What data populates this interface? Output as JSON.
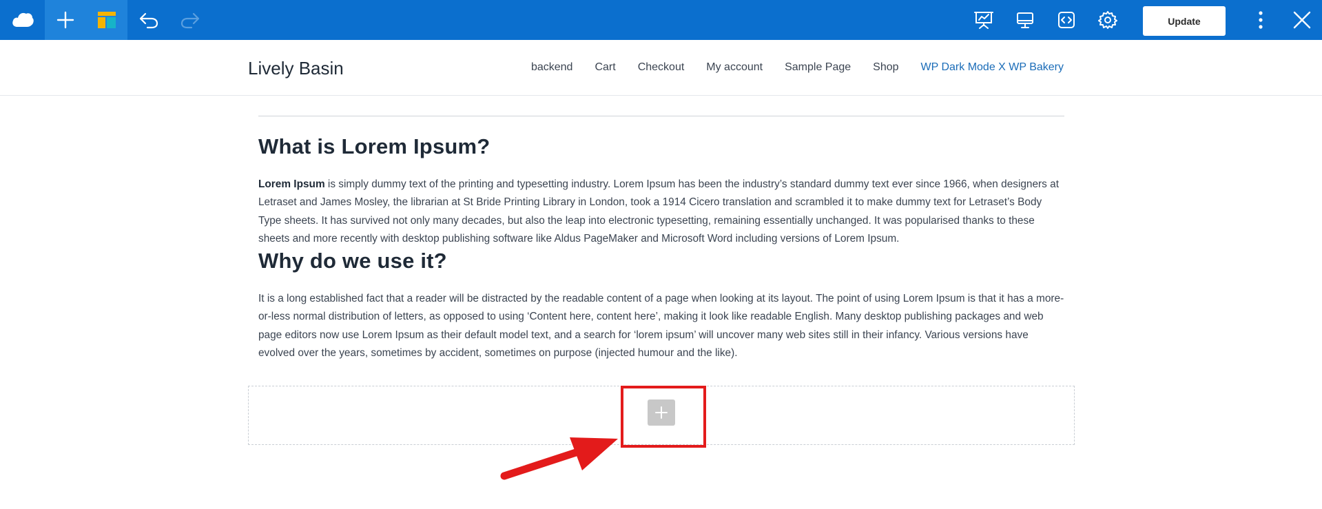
{
  "toolbar": {
    "update_label": "Update",
    "icons": [
      "logo-cloud-icon",
      "add-element-icon",
      "templates-icon",
      "undo-icon",
      "redo-icon",
      "presentation-icon",
      "desktop-preview-icon",
      "code-icon",
      "settings-gear-icon",
      "more-vertical-icon",
      "close-icon"
    ],
    "colors": {
      "bar": "#0b6fce",
      "active": "#1f83db"
    }
  },
  "header": {
    "site_title": "Lively Basin",
    "nav": [
      {
        "label": "backend"
      },
      {
        "label": "Cart"
      },
      {
        "label": "Checkout"
      },
      {
        "label": "My account"
      },
      {
        "label": "Sample Page"
      },
      {
        "label": "Shop"
      },
      {
        "label": "WP Dark Mode X WP Bakery",
        "current": true
      }
    ]
  },
  "content": {
    "section1": {
      "heading": "What is Lorem Ipsum?",
      "lead_bold": "Lorem Ipsum",
      "text": " is simply dummy text of the printing and typesetting industry. Lorem Ipsum has been the industry’s standard dummy text ever since 1966, when designers at Letraset and James Mosley, the librarian at St Bride Printing Library in London, took a 1914 Cicero translation and scrambled it to make dummy text for Letraset’s Body Type sheets. It has survived not only many decades, but also the leap into electronic typesetting, remaining essentially unchanged. It was popularised thanks to these sheets and more recently with desktop publishing software like Aldus PageMaker and Microsoft Word including versions of Lorem Ipsum."
    },
    "section2": {
      "heading": "Why do we use it?",
      "text": "It is a long established fact that a reader will be distracted by the readable content of a page when looking at its layout. The point of using Lorem Ipsum is that it has a more-or-less normal distribution of letters, as opposed to using ‘Content here, content here’, making it look like readable English. Many desktop publishing packages and web page editors now use Lorem Ipsum as their default model text, and a search for ‘lorem ipsum’ will uncover many web sites still in their infancy. Various versions have evolved over the years, sometimes by accident, sometimes on purpose (injected humour and the like)."
    }
  },
  "annotation": {
    "highlight_color": "#e31b1b"
  }
}
